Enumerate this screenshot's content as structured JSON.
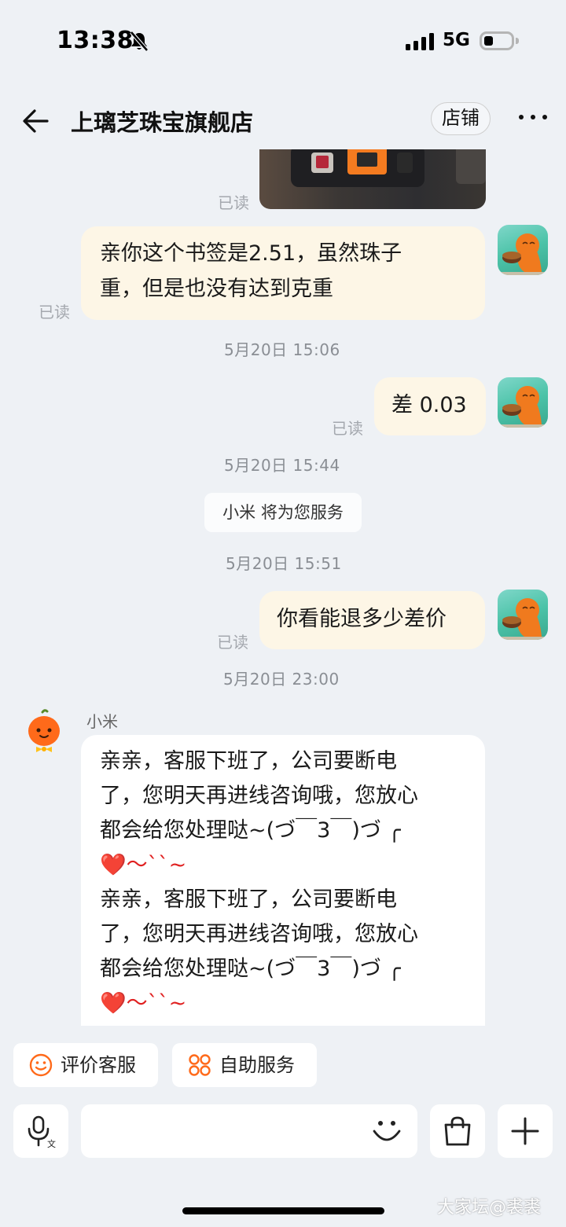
{
  "status_bar": {
    "time": "13:38",
    "network": "5G",
    "battery_level": 0.35
  },
  "header": {
    "title": "上璃芝珠宝旗舰店",
    "shop_button": "店铺"
  },
  "messages": {
    "read_label": "已读",
    "m1": {
      "lines": [
        "亲你这个书签是2.51，虽然珠子",
        "重，但是也没有达到克重"
      ]
    },
    "ts1": "5月20日 15:06",
    "m2": {
      "text": "差 0.03"
    },
    "ts2": "5月20日 15:44",
    "system": "小米 将为您服务",
    "ts3": "5月20日 15:51",
    "m3": {
      "text": "你看能退多少差价"
    },
    "ts4": "5月20日 23:00",
    "agent": {
      "name": "小米",
      "lines": [
        "亲亲，客服下班了，公司要断电",
        "了，您明天再进线咨询哦，您放心",
        "都会给您处理哒~(づ￣3￣)づ ╭",
        "❤️～``~",
        "亲亲，客服下班了，公司要断电",
        "了，您明天再进线咨询哦，您放心",
        "都会给您处理哒~(づ￣3￣)づ ╭",
        "❤️～``~"
      ]
    }
  },
  "quick_actions": {
    "rate": "评价客服",
    "self_service": "自助服务"
  },
  "colors": {
    "accent": "#ff6a1a",
    "bubble_self": "#fdf6e6",
    "background": "#eef1f5"
  },
  "watermark": "大家坛@裘裘"
}
